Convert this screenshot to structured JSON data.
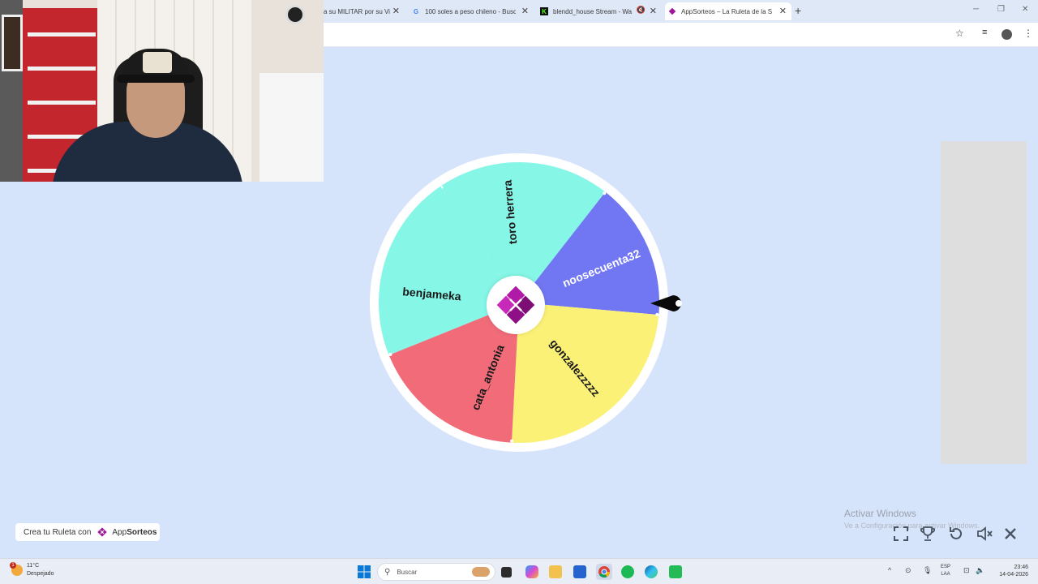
{
  "browser": {
    "tabs": [
      {
        "title": "a su MILITAR por su Vi",
        "favicon": "red-flag-icon",
        "active": false
      },
      {
        "title": "100 soles a peso chileno - Busc",
        "favicon": "google-icon",
        "active": false
      },
      {
        "title": "blendd_house Stream - Wa",
        "favicon": "kick-icon",
        "active": false,
        "muted": true
      },
      {
        "title": "AppSorteos – La Ruleta de la Su",
        "favicon": "appsorteos-icon",
        "active": true
      }
    ],
    "new_tab": "+",
    "close_glyph": "✕"
  },
  "wheel": {
    "segments": [
      {
        "label": "toro herrera",
        "color": "#86f6e6"
      },
      {
        "label": "noosecuenta32",
        "color": "#7177f2"
      },
      {
        "label": "gonzalezzzzz",
        "color": "#fbf176"
      },
      {
        "label": "cata_antonia",
        "color": "#f16b79"
      },
      {
        "label": "benjameka",
        "color": "#86f6e6"
      }
    ],
    "logo": "appsorteos-logo-icon"
  },
  "watermark": {
    "title": "Activar Windows",
    "subtitle": "Ve a Configuración para activar Windows."
  },
  "credit": {
    "prefix": "Crea tu Ruleta con",
    "brand_light": "App",
    "brand_bold": "Sorteos"
  },
  "controls": [
    "fullscreen-icon",
    "trophy-icon",
    "reset-icon",
    "sound-off-icon",
    "close-icon"
  ],
  "taskbar": {
    "weather_temp": "11°C",
    "weather_desc": "Despejado",
    "weather_badge": "1",
    "search_placeholder": "Buscar",
    "lang_top": "ESP",
    "lang_bottom": "LAA",
    "time": "23:46",
    "date": "14-04-2026"
  },
  "colors": {
    "page_bg": "#d6e4fb",
    "brand": "#a0179a"
  }
}
